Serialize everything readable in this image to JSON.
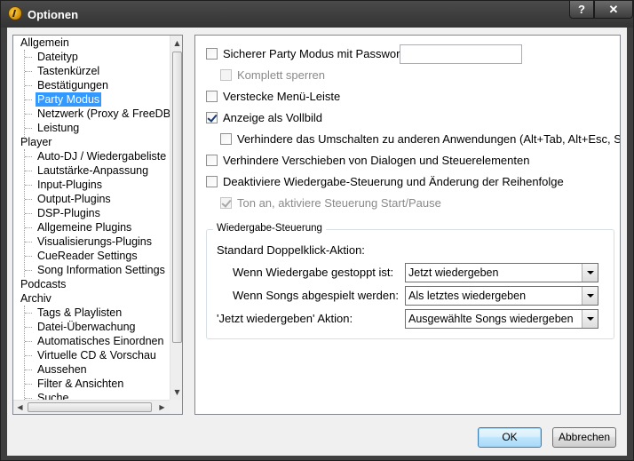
{
  "window": {
    "title": "Optionen",
    "help_label": "?",
    "close_label": "✕"
  },
  "tree": {
    "items": [
      {
        "label": "Allgemein",
        "level": 0
      },
      {
        "label": "Dateityp",
        "level": 1
      },
      {
        "label": "Tastenkürzel",
        "level": 1
      },
      {
        "label": "Bestätigungen",
        "level": 1
      },
      {
        "label": "Party Modus",
        "level": 1,
        "selected": true
      },
      {
        "label": "Netzwerk (Proxy & FreeDB)",
        "level": 1
      },
      {
        "label": "Leistung",
        "level": 1
      },
      {
        "label": "Player",
        "level": 0
      },
      {
        "label": "Auto-DJ / Wiedergabeliste",
        "level": 1
      },
      {
        "label": "Lautstärke-Anpassung",
        "level": 1
      },
      {
        "label": "Input-Plugins",
        "level": 1
      },
      {
        "label": "Output-Plugins",
        "level": 1
      },
      {
        "label": "DSP-Plugins",
        "level": 1
      },
      {
        "label": "Allgemeine Plugins",
        "level": 1
      },
      {
        "label": "Visualisierungs-Plugins",
        "level": 1
      },
      {
        "label": "CueReader Settings",
        "level": 1
      },
      {
        "label": "Song Information Settings",
        "level": 1
      },
      {
        "label": "Podcasts",
        "level": 0
      },
      {
        "label": "Archiv",
        "level": 0
      },
      {
        "label": "Tags & Playlisten",
        "level": 1
      },
      {
        "label": "Datei-Überwachung",
        "level": 1
      },
      {
        "label": "Automatisches Einordnen",
        "level": 1
      },
      {
        "label": "Virtuelle CD & Vorschau",
        "level": 1
      },
      {
        "label": "Aussehen",
        "level": 1
      },
      {
        "label": "Filter & Ansichten",
        "level": 1
      },
      {
        "label": "Suche",
        "level": 1
      }
    ]
  },
  "options": {
    "safe_party_mode": {
      "label": "Sicherer Party Modus mit Passwor",
      "checked": false,
      "password_value": ""
    },
    "lock_completely": {
      "label": "Komplett sperren",
      "checked": false,
      "disabled": true
    },
    "hide_menu_bar": {
      "label": "Verstecke Menü-Leiste",
      "checked": false
    },
    "fullscreen": {
      "label": "Anzeige als Vollbild",
      "checked": true
    },
    "prevent_switching": {
      "label": "Verhindere das Umschalten zu anderen Anwendungen (Alt+Tab, Alt+Esc, S",
      "checked": false
    },
    "prevent_moving": {
      "label": "Verhindere Verschieben von Dialogen und Steuerelementen",
      "checked": false
    },
    "disable_playback_control": {
      "label": "Deaktiviere Wiedergabe-Steuerung und Änderung der Reihenfolge",
      "checked": false
    },
    "enable_start_pause": {
      "label": "Ton an, aktiviere Steuerung Start/Pause",
      "checked": true,
      "disabled": true
    }
  },
  "playback_group": {
    "legend": "Wiedergabe-Steuerung",
    "default_action_label": "Standard Doppelklick-Aktion:",
    "when_stopped_label": "Wenn Wiedergabe gestoppt ist:",
    "when_stopped_value": "Jetzt wiedergeben",
    "when_playing_label": "Wenn Songs abgespielt werden:",
    "when_playing_value": "Als letztes wiedergeben",
    "play_now_action_label": "'Jetzt wiedergeben' Aktion:",
    "play_now_action_value": "Ausgewählte Songs wiedergeben"
  },
  "buttons": {
    "ok": "OK",
    "cancel": "Abbrechen"
  }
}
